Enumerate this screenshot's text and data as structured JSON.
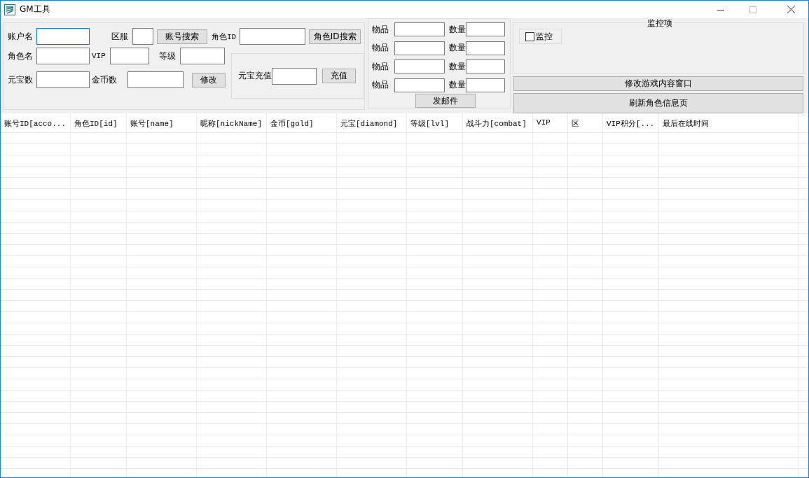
{
  "window": {
    "title": "GM工具"
  },
  "search_panel": {
    "account_name": {
      "label": "账户名",
      "focused": true
    },
    "server": {
      "label": "区服",
      "focused": false
    },
    "account_search_button": "账号搜索",
    "role_id": {
      "label": "角色ID",
      "focused": false
    },
    "role_id_search_button": "角色ID搜索",
    "role_name": {
      "label": "角色名",
      "focused": false
    },
    "vip": {
      "label": "VIP",
      "focused": false
    },
    "level": {
      "label": "等级",
      "focused": false
    },
    "diamond_count": {
      "label": "元宝数",
      "focused": false
    },
    "gold_count": {
      "label": "金币数",
      "focused": false
    },
    "modify_button": "修改",
    "recharge": {
      "label": "元宝充值",
      "button": "充值"
    }
  },
  "mail_panel": {
    "rows": [
      {
        "item_label": "物品",
        "quantity_label": "数量"
      },
      {
        "item_label": "物品",
        "quantity_label": "数量"
      },
      {
        "item_label": "物品",
        "quantity_label": "数量"
      },
      {
        "item_label": "物品",
        "quantity_label": "数量"
      }
    ],
    "send_button": "发邮件"
  },
  "monitor_panel": {
    "title": "监控项",
    "checkbox": {
      "label": "监控",
      "checked": false
    },
    "buttons": [
      "修改游戏内容窗口",
      "刷新角色信息页"
    ]
  },
  "table": {
    "columns": [
      "账号ID[acco...",
      "角色ID[id]",
      "账号[name]",
      "昵称[nickName]",
      "金币[gold]",
      "元宝[diamond]",
      "等级[lvl]",
      "战斗力[combat]",
      "VIP",
      "区",
      "VIP积分[...",
      "最后在线时间"
    ]
  }
}
